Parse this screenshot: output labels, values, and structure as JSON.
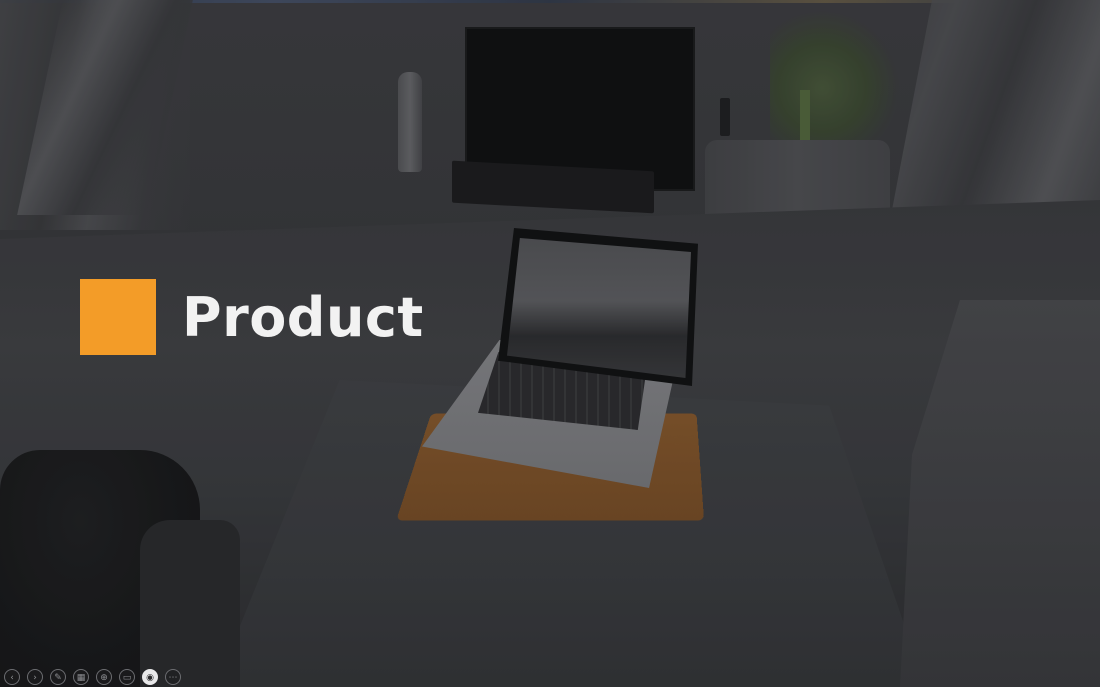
{
  "slide": {
    "title": "Product",
    "accent_color": "#f39c28",
    "background_description": "room-photo"
  },
  "toolbar": {
    "buttons": [
      {
        "name": "previous-slide-icon",
        "glyph": "‹"
      },
      {
        "name": "next-slide-icon",
        "glyph": "›"
      },
      {
        "name": "pen-icon",
        "glyph": "✎"
      },
      {
        "name": "slides-grid-icon",
        "glyph": "▦"
      },
      {
        "name": "zoom-icon",
        "glyph": "⊕"
      },
      {
        "name": "subtitles-icon",
        "glyph": "▭"
      },
      {
        "name": "camera-icon",
        "glyph": "◉"
      },
      {
        "name": "more-options-icon",
        "glyph": "⋯"
      }
    ]
  }
}
